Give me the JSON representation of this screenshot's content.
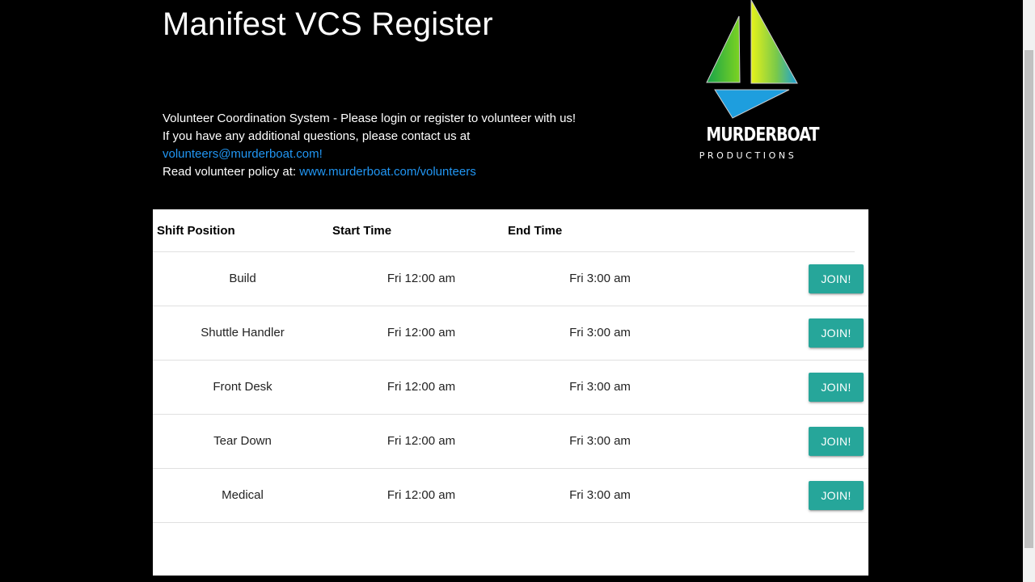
{
  "header": {
    "title": "Manifest VCS Register"
  },
  "intro": {
    "line1": "Volunteer Coordination System - Please login or register to volunteer with us!",
    "line2": "If you have any additional questions, please contact us at",
    "email_link": "volunteers@murderboat.com!",
    "policy_prefix": "Read volunteer policy at:",
    "policy_link": "www.murderboat.com/volunteers"
  },
  "logo": {
    "wordmark": "MURDERBOAT",
    "subtitle": "PRODUCTIONS"
  },
  "table": {
    "headers": {
      "position": "Shift Position",
      "start": "Start Time",
      "end": "End Time"
    },
    "rows": [
      {
        "position": "Build",
        "start": "Fri 12:00 am",
        "end": "Fri 3:00 am",
        "action": "JOIN!"
      },
      {
        "position": "Shuttle Handler",
        "start": "Fri 12:00 am",
        "end": "Fri 3:00 am",
        "action": "JOIN!"
      },
      {
        "position": "Front Desk",
        "start": "Fri 12:00 am",
        "end": "Fri 3:00 am",
        "action": "JOIN!"
      },
      {
        "position": "Tear Down",
        "start": "Fri 12:00 am",
        "end": "Fri 3:00 am",
        "action": "JOIN!"
      },
      {
        "position": "Medical",
        "start": "Fri 12:00 am",
        "end": "Fri 3:00 am",
        "action": "JOIN!"
      }
    ]
  },
  "colors": {
    "background": "#000000",
    "link": "#2196f3",
    "join_button": "#26a69a"
  },
  "icons": {
    "logo": "sailboat-logo-icon"
  }
}
